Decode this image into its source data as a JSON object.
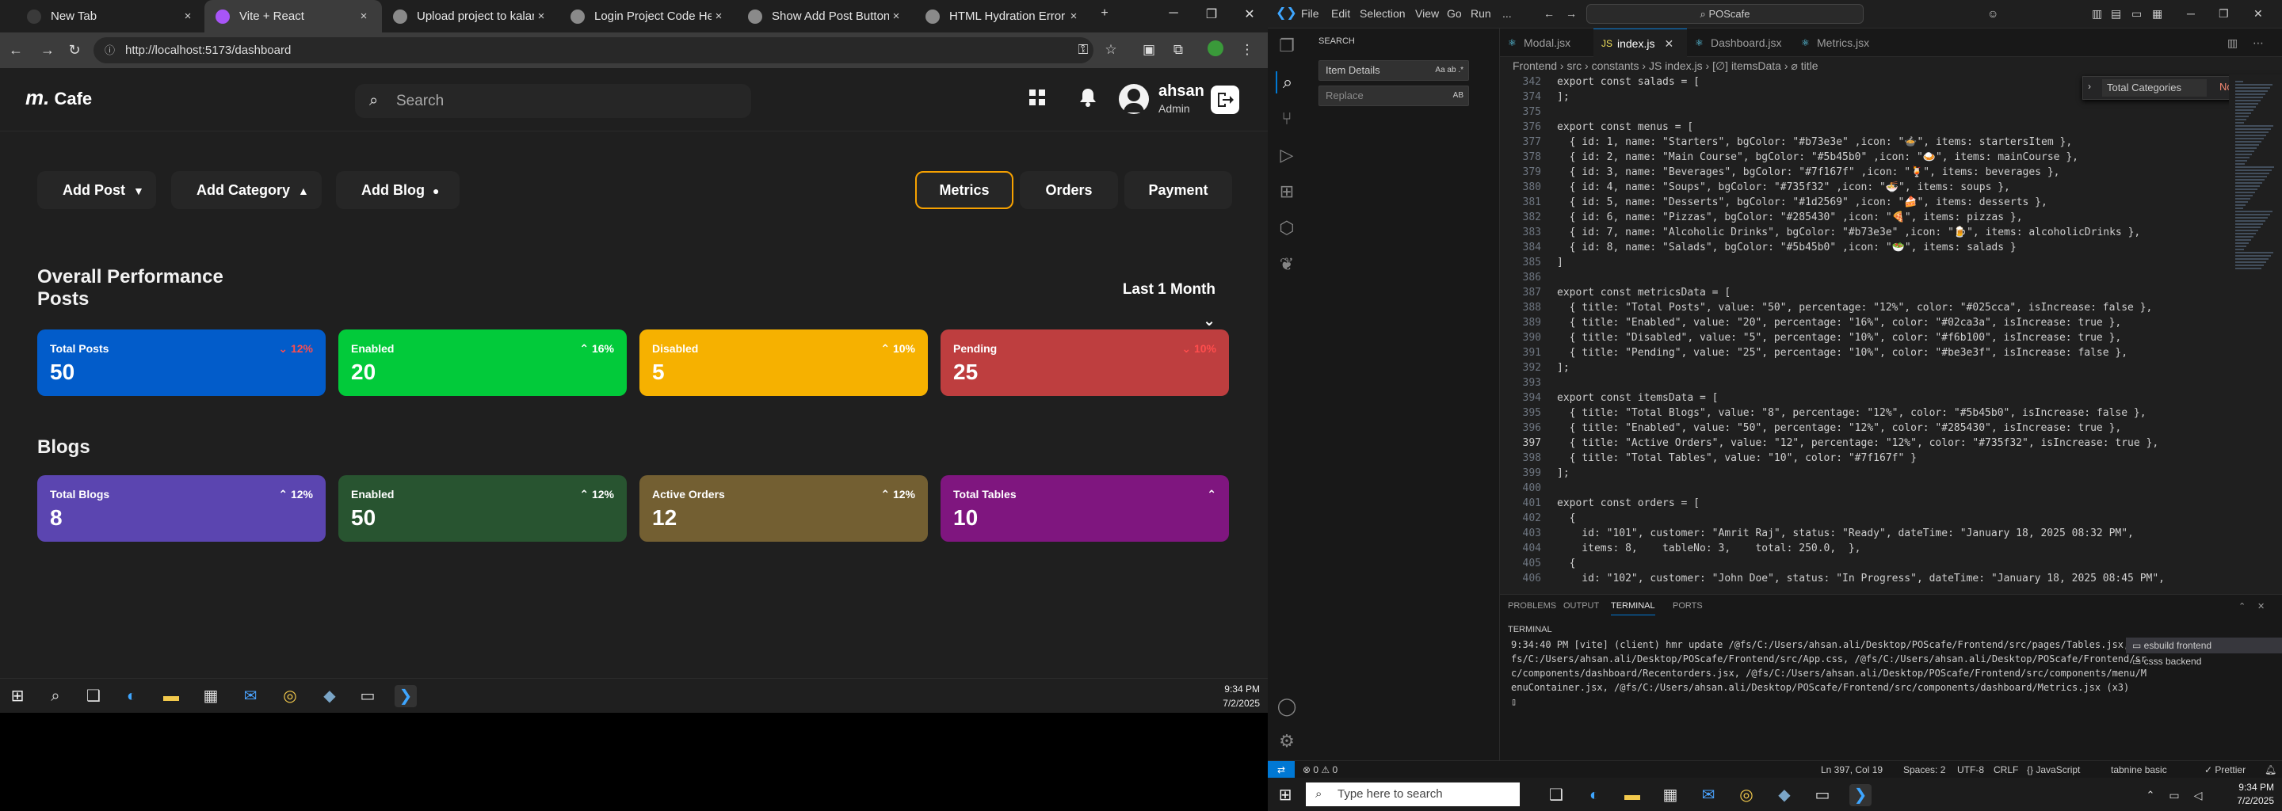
{
  "browser": {
    "tabs": [
      {
        "label": "New Tab",
        "icon_color": "#3a3a3a"
      },
      {
        "label": "Vite + React",
        "icon_color": "#a855f7",
        "active": true
      },
      {
        "label": "Upload project to kalams.org",
        "icon_color": "#8a8a8a"
      },
      {
        "label": "Login Project Code Help",
        "icon_color": "#8a8a8a"
      },
      {
        "label": "Show Add Post Button",
        "icon_color": "#8a8a8a"
      },
      {
        "label": "HTML Hydration Error Fix",
        "icon_color": "#8a8a8a"
      }
    ],
    "url": "http://localhost:5173/dashboard",
    "close_glyph": "×",
    "new_tab_glyph": "+"
  },
  "app": {
    "logo_mark": "m.",
    "logo_text": "Cafe",
    "search_placeholder": "Search",
    "user_name": "ahsan",
    "user_role": "Admin",
    "actions": [
      {
        "label": "Add Post",
        "icon": "post-icon"
      },
      {
        "label": "Add Category",
        "icon": "category-icon"
      },
      {
        "label": "Add Blog",
        "icon": "blog-icon"
      }
    ],
    "view_tabs": [
      {
        "label": "Metrics",
        "active": true
      },
      {
        "label": "Orders"
      },
      {
        "label": "Payment"
      }
    ],
    "overview_title": "Overall Performance",
    "posts_title": "Posts",
    "blogs_title": "Blogs",
    "period": "Last 1 Month",
    "posts": [
      {
        "title": "Total Posts",
        "value": "50",
        "pct": "12%",
        "color": "#025cca",
        "up": false
      },
      {
        "title": "Enabled",
        "value": "20",
        "pct": "16%",
        "color": "#02ca3a",
        "up": true
      },
      {
        "title": "Disabled",
        "value": "5",
        "pct": "10%",
        "color": "#f6b100",
        "up": true
      },
      {
        "title": "Pending",
        "value": "25",
        "pct": "10%",
        "color": "#be3e3f",
        "up": false
      }
    ],
    "blogs": [
      {
        "title": "Total Blogs",
        "value": "8",
        "pct": "12%",
        "color": "#5b45b0",
        "up": true
      },
      {
        "title": "Enabled",
        "value": "50",
        "pct": "12%",
        "color": "#285430",
        "up": true
      },
      {
        "title": "Active Orders",
        "value": "12",
        "pct": "12%",
        "color": "#735f32",
        "up": true
      },
      {
        "title": "Total Tables",
        "value": "10",
        "pct": "",
        "color": "#7f167f",
        "up": true
      }
    ]
  },
  "taskbar_left": {
    "time": "9:34 PM",
    "date": "7/2/2025"
  },
  "vscode": {
    "menu": [
      "File",
      "Edit",
      "Selection",
      "View",
      "Go",
      "Run",
      "..."
    ],
    "command_center": "POScafe",
    "side_header": "SEARCH",
    "search_value": "Item Details",
    "replace_placeholder": "Replace",
    "tabs": [
      {
        "label": "Modal.jsx"
      },
      {
        "label": "index.js",
        "active": true
      },
      {
        "label": "Dashboard.jsx"
      },
      {
        "label": "Metrics.jsx"
      }
    ],
    "breadcrumb": "Frontend › src › constants › JS index.js › [∅] itemsData › ⌀ title",
    "find_value": "Total Categories",
    "find_result": "No results",
    "code": [
      {
        "n": "342",
        "t": "export const salads = ["
      },
      {
        "n": "374",
        "t": "];"
      },
      {
        "n": "375",
        "t": ""
      },
      {
        "n": "376",
        "t": "export const menus = ["
      },
      {
        "n": "377",
        "t": "  { id: 1, name: \"Starters\", bgColor: \"#b73e3e\" ,icon: \"🍲\", items: startersItem },"
      },
      {
        "n": "378",
        "t": "  { id: 2, name: \"Main Course\", bgColor: \"#5b45b0\" ,icon: \"🍛\", items: mainCourse },"
      },
      {
        "n": "379",
        "t": "  { id: 3, name: \"Beverages\", bgColor: \"#7f167f\" ,icon: \"🍹\", items: beverages },"
      },
      {
        "n": "380",
        "t": "  { id: 4, name: \"Soups\", bgColor: \"#735f32\" ,icon: \"🍜\", items: soups },"
      },
      {
        "n": "381",
        "t": "  { id: 5, name: \"Desserts\", bgColor: \"#1d2569\" ,icon: \"🍰\", items: desserts },"
      },
      {
        "n": "382",
        "t": "  { id: 6, name: \"Pizzas\", bgColor: \"#285430\" ,icon: \"🍕\", items: pizzas },"
      },
      {
        "n": "383",
        "t": "  { id: 7, name: \"Alcoholic Drinks\", bgColor: \"#b73e3e\" ,icon: \"🍺\", items: alcoholicDrinks },"
      },
      {
        "n": "384",
        "t": "  { id: 8, name: \"Salads\", bgColor: \"#5b45b0\" ,icon: \"🥗\", items: salads }"
      },
      {
        "n": "385",
        "t": "]"
      },
      {
        "n": "386",
        "t": ""
      },
      {
        "n": "387",
        "t": "export const metricsData = ["
      },
      {
        "n": "388",
        "t": "  { title: \"Total Posts\", value: \"50\", percentage: \"12%\", color: \"#025cca\", isIncrease: false },"
      },
      {
        "n": "389",
        "t": "  { title: \"Enabled\", value: \"20\", percentage: \"16%\", color: \"#02ca3a\", isIncrease: true },"
      },
      {
        "n": "390",
        "t": "  { title: \"Disabled\", value: \"5\", percentage: \"10%\", color: \"#f6b100\", isIncrease: true },"
      },
      {
        "n": "391",
        "t": "  { title: \"Pending\", value: \"25\", percentage: \"10%\", color: \"#be3e3f\", isIncrease: false },"
      },
      {
        "n": "392",
        "t": "];"
      },
      {
        "n": "393",
        "t": ""
      },
      {
        "n": "394",
        "t": "export const itemsData = ["
      },
      {
        "n": "395",
        "t": "  { title: \"Total Blogs\", value: \"8\", percentage: \"12%\", color: \"#5b45b0\", isIncrease: false },"
      },
      {
        "n": "396",
        "t": "  { title: \"Enabled\", value: \"50\", percentage: \"12%\", color: \"#285430\", isIncrease: true },"
      },
      {
        "n": "397",
        "t": "  { title: \"Active Orders\", value: \"12\", percentage: \"12%\", color: \"#735f32\", isIncrease: true },",
        "cur": true
      },
      {
        "n": "398",
        "t": "  { title: \"Total Tables\", value: \"10\", color: \"#7f167f\" }"
      },
      {
        "n": "399",
        "t": "];"
      },
      {
        "n": "400",
        "t": ""
      },
      {
        "n": "401",
        "t": "export const orders = ["
      },
      {
        "n": "402",
        "t": "  {"
      },
      {
        "n": "403",
        "t": "    id: \"101\", customer: \"Amrit Raj\", status: \"Ready\", dateTime: \"January 18, 2025 08:32 PM\","
      },
      {
        "n": "404",
        "t": "    items: 8,    tableNo: 3,    total: 250.0,  },"
      },
      {
        "n": "405",
        "t": "  {"
      },
      {
        "n": "406",
        "t": "    id: \"102\", customer: \"John Doe\", status: \"In Progress\", dateTime: \"January 18, 2025 08:45 PM\","
      }
    ],
    "panel_tabs": [
      "PROBLEMS",
      "OUTPUT",
      "TERMINAL",
      "PORTS"
    ],
    "terminal_title": "TERMINAL",
    "terminal_lines": [
      "9:34:40 PM [vite] (client) hmr update /@fs/C:/Users/ahsan.ali/Desktop/POScafe/Frontend/src/pages/Tables.jsx, /@",
      "fs/C:/Users/ahsan.ali/Desktop/POScafe/Frontend/src/App.css, /@fs/C:/Users/ahsan.ali/Desktop/POScafe/Frontend/sr",
      "c/components/dashboard/Recentorders.jsx, /@fs/C:/Users/ahsan.ali/Desktop/POScafe/Frontend/src/components/menu/M",
      "enuContainer.jsx, /@fs/C:/Users/ahsan.ali/Desktop/POScafe/Frontend/src/components/dashboard/Metrics.jsx (x3)",
      "▯"
    ],
    "terminals": [
      {
        "label": "esbuild  frontend",
        "active": true
      },
      {
        "label": "csss  backend"
      }
    ],
    "status": {
      "problems": "⊗ 0  ⚠ 0",
      "position": "Ln 397, Col 19",
      "spaces": "Spaces: 2",
      "encoding": "UTF-8",
      "eol": "CRLF",
      "lang": "{} JavaScript",
      "tabnine": "tabnine basic",
      "prettier": "✓ Prettier"
    },
    "taskbar_search": "Type here to search",
    "time": "9:34 PM",
    "date": "7/2/2025"
  }
}
